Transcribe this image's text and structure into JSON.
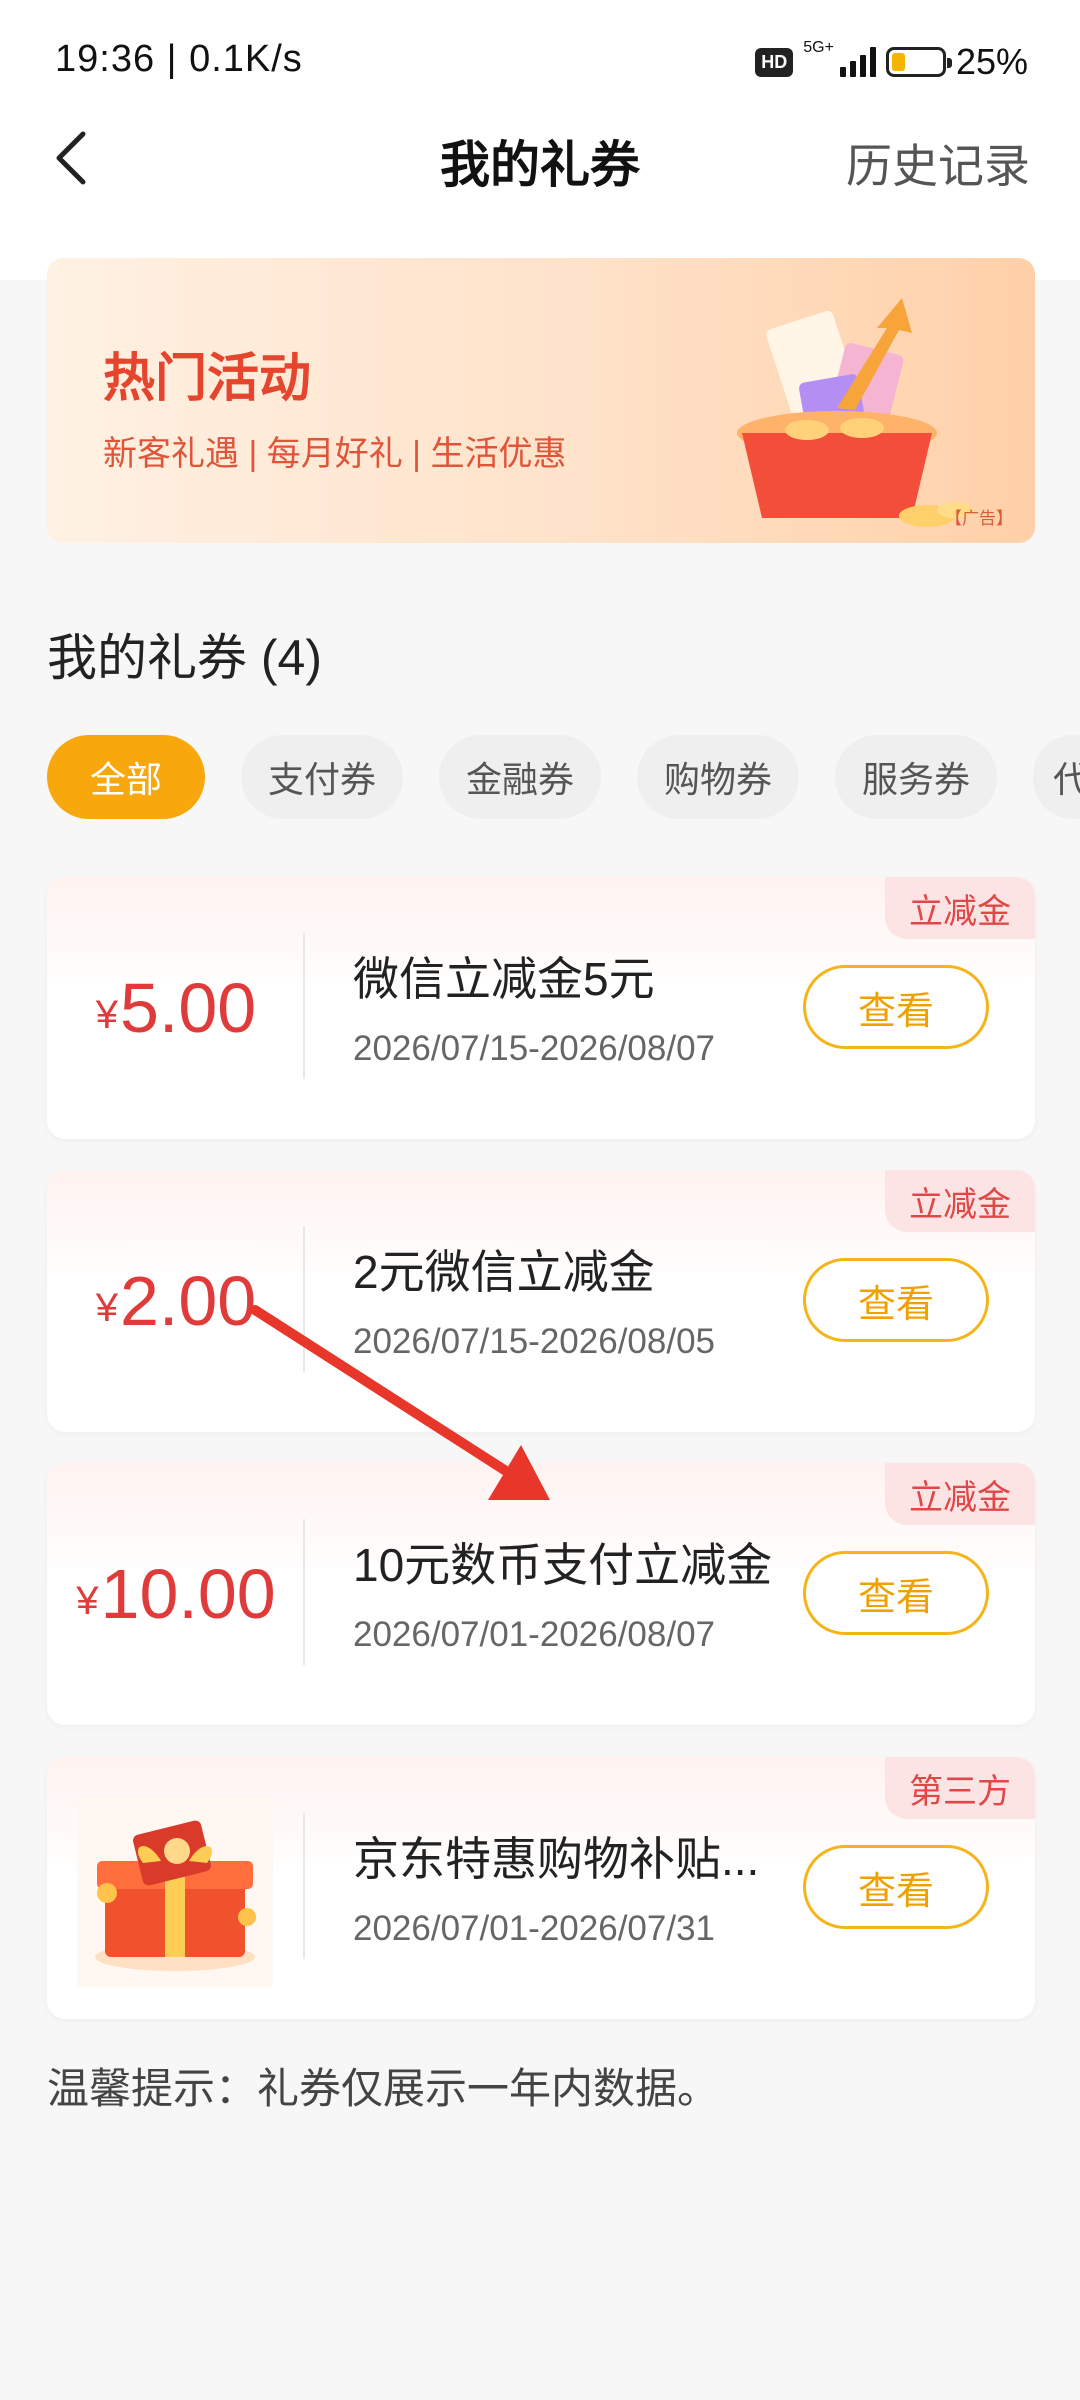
{
  "status_bar": {
    "time_speed": "19:36 | 0.1K/s",
    "hd": "HD",
    "network": "5G+",
    "battery_percent": "25%",
    "battery_level": 0.25
  },
  "header": {
    "title": "我的礼券",
    "history_label": "历史记录",
    "back_icon": "chevron-left-icon"
  },
  "banner": {
    "title": "热门活动",
    "subtitle": "新客礼遇 | 每月好礼 | 生活优惠",
    "ad_label": "【广告】"
  },
  "section": {
    "title": "我的礼券 (4)"
  },
  "tabs": [
    {
      "label": "全部",
      "active": true
    },
    {
      "label": "支付券",
      "active": false
    },
    {
      "label": "金融券",
      "active": false
    },
    {
      "label": "购物券",
      "active": false
    },
    {
      "label": "服务券",
      "active": false
    },
    {
      "label": "代",
      "active": false
    }
  ],
  "coupons": [
    {
      "yen": "¥",
      "amount": "5.00",
      "name": "微信立减金5元",
      "date": "2026/07/15-2026/08/07",
      "tag": "立减金",
      "button": "查看"
    },
    {
      "yen": "¥",
      "amount": "2.00",
      "name": "2元微信立减金",
      "date": "2026/07/15-2026/08/05",
      "tag": "立减金",
      "button": "查看"
    },
    {
      "yen": "¥",
      "amount": "10.00",
      "name": "10元数币支付立减金",
      "date": "2026/07/01-2026/08/07",
      "tag": "立减金",
      "button": "查看"
    },
    {
      "yen": "",
      "amount": "",
      "name": "京东特惠购物补贴...",
      "date": "2026/07/01-2026/07/31",
      "tag": "第三方",
      "button": "查看",
      "image_icon": "gift-box-icon"
    }
  ],
  "tip": "温馨提示：礼券仅展示一年内数据。",
  "colors": {
    "accent": "#f8a70c",
    "amount_red": "#e03b3b",
    "arrow_red": "#e8362a"
  }
}
